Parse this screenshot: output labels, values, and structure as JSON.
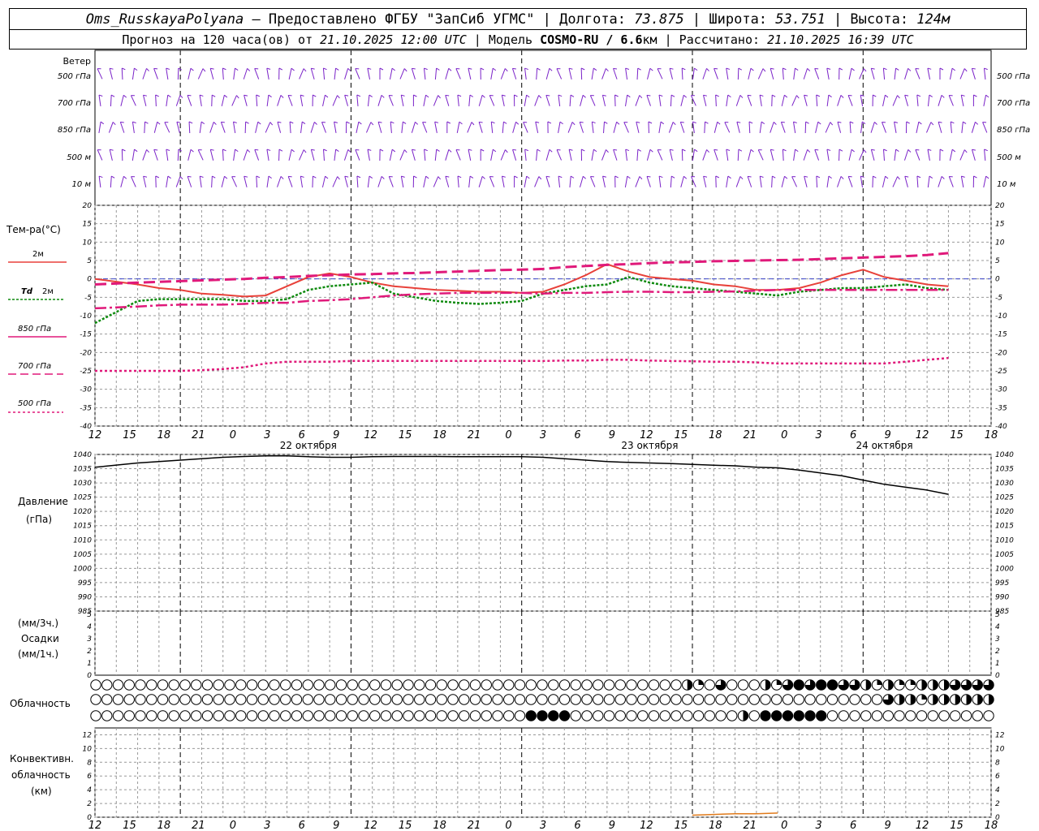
{
  "header": {
    "station": "Oms_RusskayaPolyana",
    "provider": " – Предоставлено ФГБУ \"ЗапСиб УГМС\" | Долгота: ",
    "lon": "73.875",
    "lat_label": " | Широта: ",
    "lat": "53.751",
    "alt_label": " | Высота: ",
    "alt": "124м",
    "forecast_label": "Прогноз на 120 часа(ов) от ",
    "forecast_time": "21.10.2025 12:00 UTC",
    "model_label": "  | Модель ",
    "model": "COSMO-RU / 6.6",
    "model_unit": "км | Рассчитано: ",
    "computed": "21.10.2025 16:39 UTC"
  },
  "colors": {
    "t2m": "#e8413a",
    "td2m": "#0e8a0e",
    "upper": "#e0197a",
    "wind": "#7a22c8",
    "conv": "#e07a1a",
    "pressure": "#000000"
  },
  "labels": {
    "wind_title": "Ветер",
    "wind_levels": [
      "500 гПа",
      "700 гПа",
      "850 гПа",
      "500 м",
      "10  м"
    ],
    "temp_title": "Тем-ра(°С)",
    "legend_2m": "2м",
    "legend_td": "Td",
    "legend_td_2m": "2м",
    "legend_850": "850 гПа",
    "legend_700": "700 гПа",
    "legend_500": "500 гПа",
    "pressure_title": "Давление",
    "pressure_unit": "(гПа)",
    "precip_unit1": "(мм/3ч.)",
    "precip_title": "Осадки",
    "precip_unit2": "(мм/1ч.)",
    "cloud_title": "Облачность",
    "conv_title1": "Конвективн.",
    "conv_title2": "облачность",
    "conv_unit": "(км)"
  },
  "chart_data": [
    {
      "type": "line",
      "title": "Тем-ра(°С)",
      "x_hour_ticks": [
        "12",
        "15",
        "18",
        "21",
        "0",
        "3",
        "6",
        "9",
        "12",
        "15",
        "18",
        "21",
        "0",
        "3",
        "6",
        "9",
        "12",
        "15",
        "18",
        "21",
        "0",
        "3",
        "6",
        "9",
        "12",
        "15",
        "18"
      ],
      "date_labels": [
        "22 октября",
        "23 октября",
        "24 октября"
      ],
      "ylim": [
        -40,
        20
      ],
      "yticks": [
        20,
        15,
        10,
        5,
        0,
        -5,
        -10,
        -15,
        -20,
        -25,
        -30,
        -35,
        -40
      ],
      "x_hours": [
        0,
        6,
        9,
        12,
        15,
        18,
        21,
        24,
        27,
        30,
        33,
        36,
        39,
        42,
        45,
        48,
        51,
        54,
        57,
        60,
        63,
        66,
        69,
        72,
        75,
        78,
        81,
        84,
        87,
        90,
        93,
        96,
        99,
        102,
        105,
        108,
        111,
        114,
        117,
        120
      ],
      "series": [
        {
          "name": "2м",
          "values": [
            0,
            -1.5,
            -2.5,
            -3,
            -4,
            -4.3,
            -4.8,
            -4.5,
            -2,
            0.5,
            1.5,
            0.5,
            -1,
            -2,
            -2.5,
            -3,
            -3.2,
            -3.5,
            -3.5,
            -3.8,
            -3.5,
            -1.5,
            1,
            4,
            2,
            0.5,
            0,
            -0.5,
            -1.5,
            -2,
            -3,
            -3,
            -2.5,
            -1,
            1,
            2.5,
            0.5,
            -0.5,
            -1.5,
            -2
          ]
        },
        {
          "name": "Td 2м",
          "values": [
            -12,
            -6,
            -5.5,
            -5.5,
            -5.5,
            -5.5,
            -6,
            -6,
            -5.5,
            -3,
            -2,
            -1.5,
            -1,
            -4,
            -5,
            -6,
            -6.5,
            -6.8,
            -6.5,
            -6,
            -4,
            -3,
            -2,
            -1.5,
            0.5,
            -1,
            -2,
            -2.5,
            -3,
            -3.5,
            -4,
            -4.5,
            -3.5,
            -3,
            -2.5,
            -2.5,
            -2,
            -1.5,
            -2.5,
            -3
          ]
        },
        {
          "name": "850 гПа",
          "values": [
            -8,
            -7.5,
            -7.2,
            -7,
            -7,
            -7,
            -6.8,
            -6.5,
            -6.5,
            -6,
            -5.8,
            -5.5,
            -5,
            -4.5,
            -4.2,
            -4,
            -3.8,
            -3.8,
            -3.8,
            -3.8,
            -4,
            -3.8,
            -3.8,
            -3.6,
            -3.5,
            -3.5,
            -3.6,
            -3.6,
            -3.5,
            -3.4,
            -3.2,
            -3,
            -3,
            -3,
            -3,
            -3,
            -3,
            -3,
            -3,
            -3
          ]
        },
        {
          "name": "700 гПа",
          "values": [
            -1.5,
            -1,
            -0.8,
            -0.6,
            -0.4,
            -0.2,
            0,
            0.3,
            0.5,
            0.8,
            1,
            1.2,
            1.3,
            1.5,
            1.6,
            1.8,
            2,
            2.2,
            2.4,
            2.5,
            2.7,
            3.2,
            3.5,
            3.8,
            4,
            4.3,
            4.5,
            4.6,
            4.8,
            4.9,
            5,
            5.1,
            5.2,
            5.4,
            5.6,
            5.8,
            6,
            6.2,
            6.5,
            7
          ]
        },
        {
          "name": "500 гПа",
          "values": [
            -25,
            -25,
            -25,
            -25,
            -24.8,
            -24.5,
            -24,
            -23,
            -22.5,
            -22.5,
            -22.5,
            -22.3,
            -22.3,
            -22.3,
            -22.3,
            -22.3,
            -22.3,
            -22.3,
            -22.3,
            -22.3,
            -22.3,
            -22.2,
            -22.2,
            -22,
            -22,
            -22.2,
            -22.3,
            -22.4,
            -22.5,
            -22.5,
            -22.7,
            -23,
            -23,
            -23,
            -23,
            -23,
            -23,
            -22.5,
            -22,
            -21.5
          ]
        }
      ],
      "zero_line": true
    },
    {
      "type": "line",
      "title": "Давление (гПа)",
      "ylim": [
        985,
        1040
      ],
      "yticks": [
        1040,
        1035,
        1030,
        1025,
        1020,
        1015,
        1010,
        1005,
        1000,
        995,
        990,
        985
      ],
      "x_hours": [
        0,
        6,
        9,
        12,
        15,
        18,
        21,
        24,
        27,
        30,
        33,
        36,
        39,
        42,
        45,
        48,
        51,
        54,
        57,
        60,
        63,
        66,
        69,
        72,
        75,
        78,
        81,
        84,
        87,
        90,
        93,
        96,
        99,
        102,
        105,
        108,
        111,
        114,
        117,
        120
      ],
      "series": [
        {
          "name": "pressure",
          "values": [
            1035.5,
            1037,
            1037.5,
            1038,
            1038.5,
            1039,
            1039.3,
            1039.5,
            1039.5,
            1039.2,
            1039,
            1039,
            1039.2,
            1039.3,
            1039.3,
            1039.3,
            1039.2,
            1039.2,
            1039.2,
            1039.2,
            1039,
            1038.5,
            1038,
            1037.5,
            1037.2,
            1037,
            1036.8,
            1036.5,
            1036.2,
            1036,
            1035.5,
            1035.3,
            1034.5,
            1033.5,
            1032.5,
            1031,
            1029.5,
            1028.5,
            1027.5,
            1026
          ]
        }
      ]
    },
    {
      "type": "bar",
      "title": "Осадки",
      "ylim": [
        0,
        5
      ],
      "yticks": [
        5,
        4,
        3,
        2,
        1,
        0
      ],
      "values": []
    },
    {
      "type": "table",
      "title": "Облачность",
      "rows": 3,
      "columns": 81,
      "note": "cloud cover symbols: 0=empty,1=quarter,2=half,3=three-quarter,4=full",
      "row_values": [
        [
          0,
          0,
          0,
          0,
          0,
          0,
          0,
          0,
          0,
          0,
          0,
          0,
          0,
          0,
          0,
          0,
          0,
          0,
          0,
          0,
          0,
          0,
          0,
          0,
          0,
          0,
          0,
          0,
          0,
          0,
          0,
          0,
          0,
          0,
          0,
          0,
          0,
          0,
          0,
          0,
          0,
          0,
          0,
          0,
          0,
          0,
          0,
          0,
          0,
          0,
          0,
          0,
          0,
          2,
          1,
          0,
          3,
          0,
          0,
          0,
          2,
          1,
          3,
          4,
          3,
          4,
          4,
          3,
          3,
          2,
          1,
          2,
          1,
          1,
          2,
          2,
          2,
          3,
          3,
          3,
          3
        ],
        [
          0,
          0,
          0,
          0,
          0,
          0,
          0,
          0,
          0,
          0,
          0,
          0,
          0,
          0,
          0,
          0,
          0,
          0,
          0,
          0,
          0,
          0,
          0,
          0,
          0,
          0,
          0,
          0,
          0,
          0,
          0,
          0,
          0,
          0,
          0,
          0,
          0,
          0,
          0,
          0,
          0,
          0,
          0,
          0,
          0,
          0,
          0,
          0,
          0,
          0,
          0,
          0,
          0,
          0,
          0,
          0,
          0,
          0,
          0,
          0,
          0,
          0,
          0,
          0,
          0,
          0,
          0,
          0,
          0,
          0,
          0,
          3,
          2,
          2,
          1,
          2,
          2,
          2,
          2,
          2,
          2
        ],
        [
          0,
          0,
          0,
          0,
          0,
          0,
          0,
          0,
          0,
          0,
          0,
          0,
          0,
          0,
          0,
          0,
          0,
          0,
          0,
          0,
          0,
          0,
          0,
          0,
          0,
          0,
          0,
          0,
          0,
          0,
          0,
          0,
          0,
          0,
          0,
          0,
          0,
          0,
          0,
          4,
          4,
          4,
          4,
          0,
          0,
          0,
          0,
          0,
          0,
          0,
          0,
          0,
          0,
          0,
          0,
          0,
          0,
          0,
          2,
          0,
          4,
          4,
          4,
          4,
          4,
          4,
          0,
          0,
          0,
          0,
          0,
          0,
          0,
          0,
          0,
          0,
          0,
          0,
          0,
          0,
          0
        ]
      ]
    },
    {
      "type": "line",
      "title": "Конвективн. облачность (км)",
      "ylim": [
        0,
        13
      ],
      "yticks": [
        12,
        10,
        8,
        6,
        4,
        2,
        0
      ],
      "x_hours": [
        84,
        87,
        90,
        93,
        96
      ],
      "series": [
        {
          "name": "conv",
          "values": [
            0.3,
            0.4,
            0.5,
            0.5,
            0.6
          ]
        }
      ]
    }
  ]
}
